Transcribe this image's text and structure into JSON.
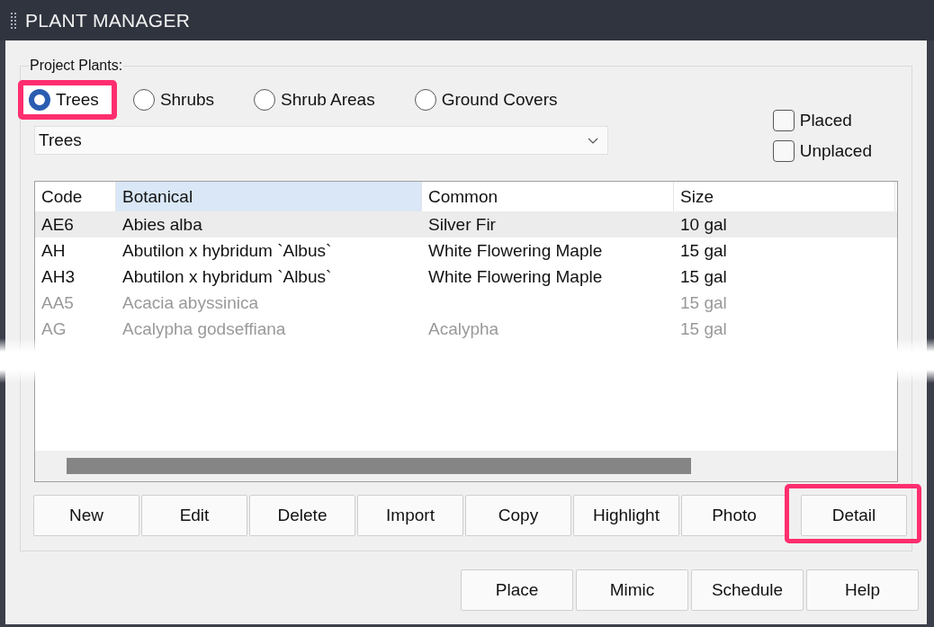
{
  "window": {
    "title": "PLANT MANAGER"
  },
  "group": {
    "label": "Project Plants:"
  },
  "radios": [
    {
      "label": "Trees",
      "selected": true,
      "highlighted": true
    },
    {
      "label": "Shrubs",
      "selected": false,
      "highlighted": false
    },
    {
      "label": "Shrub Areas",
      "selected": false,
      "highlighted": false
    },
    {
      "label": "Ground Covers",
      "selected": false,
      "highlighted": false
    }
  ],
  "dropdown": {
    "value": "Trees"
  },
  "checkboxes": [
    {
      "label": "Placed",
      "checked": false
    },
    {
      "label": "Unplaced",
      "checked": false
    }
  ],
  "table": {
    "columns": [
      {
        "label": "Code",
        "sorted": false
      },
      {
        "label": "Botanical",
        "sorted": true
      },
      {
        "label": "Common",
        "sorted": false
      },
      {
        "label": "Size",
        "sorted": false
      }
    ],
    "rows": [
      {
        "cells": [
          "AE6",
          "Abies alba",
          "Silver Fir",
          "10 gal"
        ],
        "selected": true,
        "dimmed": false
      },
      {
        "cells": [
          "AH",
          "Abutilon x hybridum `Albus`",
          "White Flowering Maple",
          "15 gal"
        ],
        "selected": false,
        "dimmed": false
      },
      {
        "cells": [
          "AH3",
          "Abutilon x hybridum `Albus`",
          "White Flowering Maple",
          "15 gal"
        ],
        "selected": false,
        "dimmed": false
      },
      {
        "cells": [
          "AA5",
          "Acacia abyssinica",
          "",
          "15 gal"
        ],
        "selected": false,
        "dimmed": true
      },
      {
        "cells": [
          "AG",
          "Acalypha godseffiana",
          "Acalypha",
          "15 gal"
        ],
        "selected": false,
        "dimmed": true
      }
    ]
  },
  "actions": [
    {
      "label": "New",
      "highlighted": false
    },
    {
      "label": "Edit",
      "highlighted": false
    },
    {
      "label": "Delete",
      "highlighted": false
    },
    {
      "label": "Import",
      "highlighted": false
    },
    {
      "label": "Copy",
      "highlighted": false
    },
    {
      "label": "Highlight",
      "highlighted": false
    },
    {
      "label": "Photo",
      "highlighted": false
    },
    {
      "label": "Detail",
      "highlighted": true
    }
  ],
  "footer_buttons": [
    "Place",
    "Mimic",
    "Schedule",
    "Help"
  ]
}
